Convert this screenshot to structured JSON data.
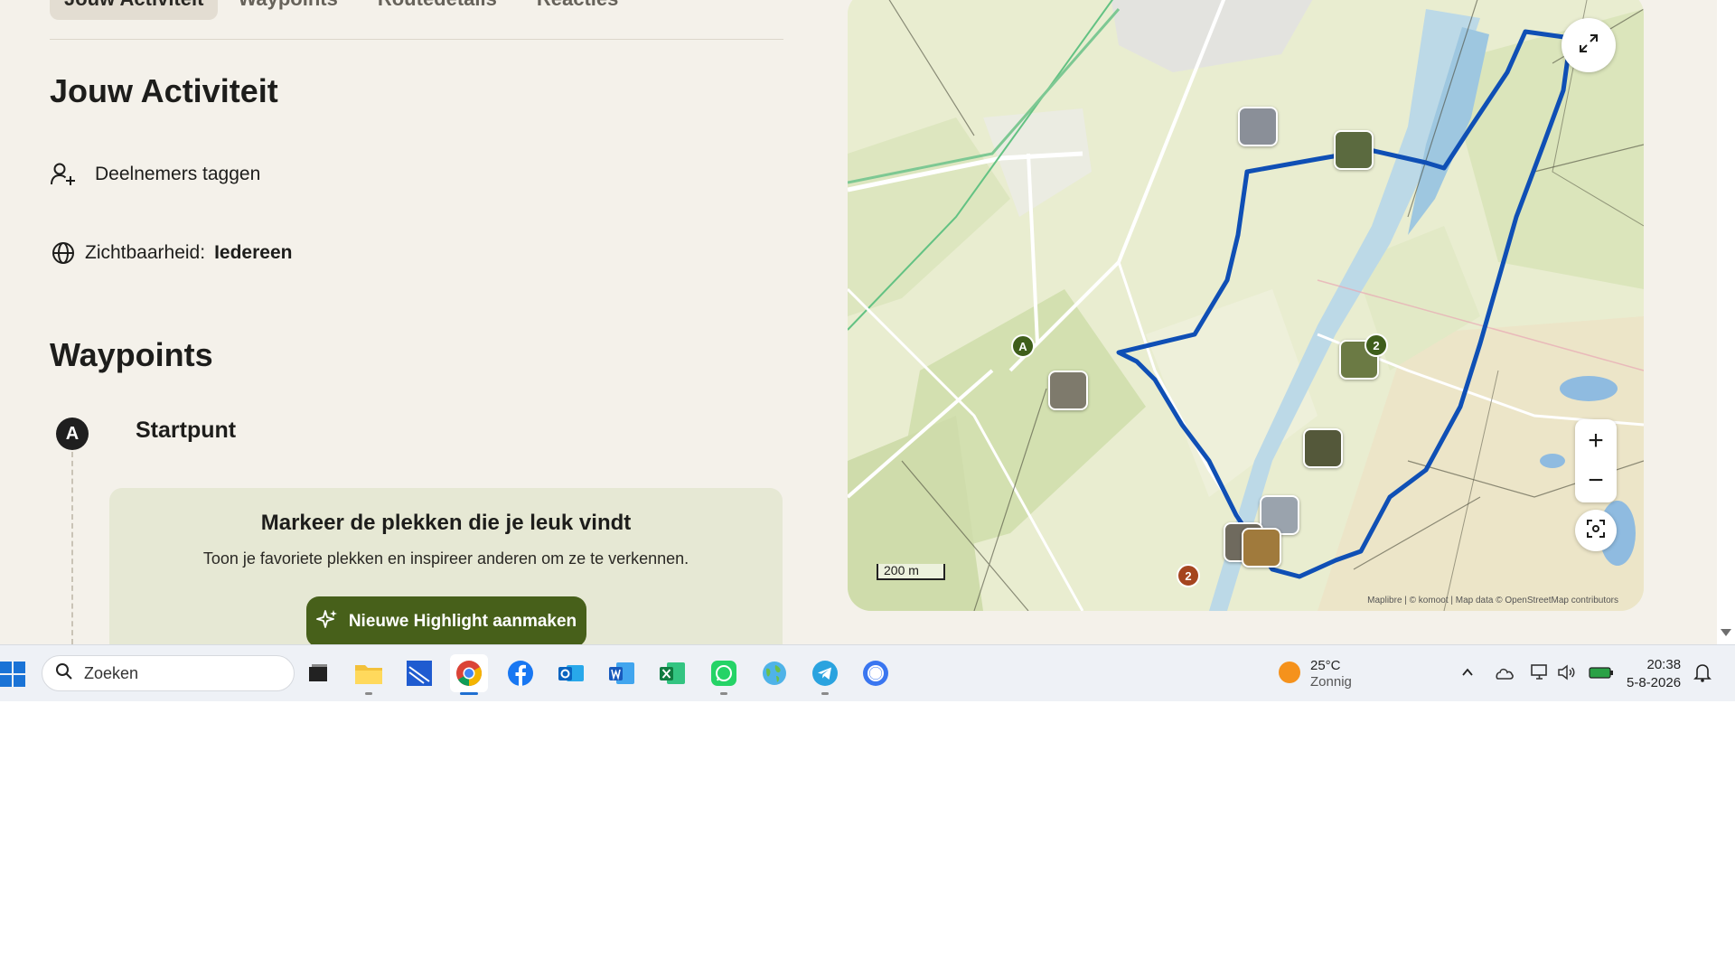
{
  "tabs": [
    {
      "label": "Jouw Activiteit",
      "active": true
    },
    {
      "label": "Waypoints"
    },
    {
      "label": "Routedetails"
    },
    {
      "label": "Reacties"
    }
  ],
  "activity": {
    "title": "Jouw Activiteit",
    "tag_label": "Deelnemers taggen",
    "visibility_label": "Zichtbaarheid:",
    "visibility_value": "Iedereen"
  },
  "waypoints": {
    "title": "Waypoints",
    "start_badge": "A",
    "start_title": "Startpunt"
  },
  "highlight_card": {
    "title": "Markeer de plekken die je leuk vindt",
    "text": "Toon je favoriete plekken en inspireer anderen om ze te verkennen.",
    "button_label": "Nieuwe Highlight aanmaken"
  },
  "map": {
    "scale_label": "200 m",
    "attribution": "Maplibre | © komoot | Map data © OpenStreetMap contributors",
    "zoom_in": "+",
    "zoom_out": "−",
    "pin_start": "A",
    "pin_two": "2",
    "pin_two_orange": "2",
    "route_color": "#0f4fb5"
  },
  "taskbar": {
    "search_placeholder": "Zoeken",
    "apps": [
      "task-view",
      "file-explorer",
      "dropbox-paper",
      "chrome",
      "facebook",
      "outlook",
      "word",
      "excel",
      "whatsapp",
      "maps",
      "telegram",
      "signal"
    ],
    "weather_temp": "25°C",
    "weather_desc": "Zonnig",
    "time": "20:38",
    "date": "5-8-2026"
  }
}
